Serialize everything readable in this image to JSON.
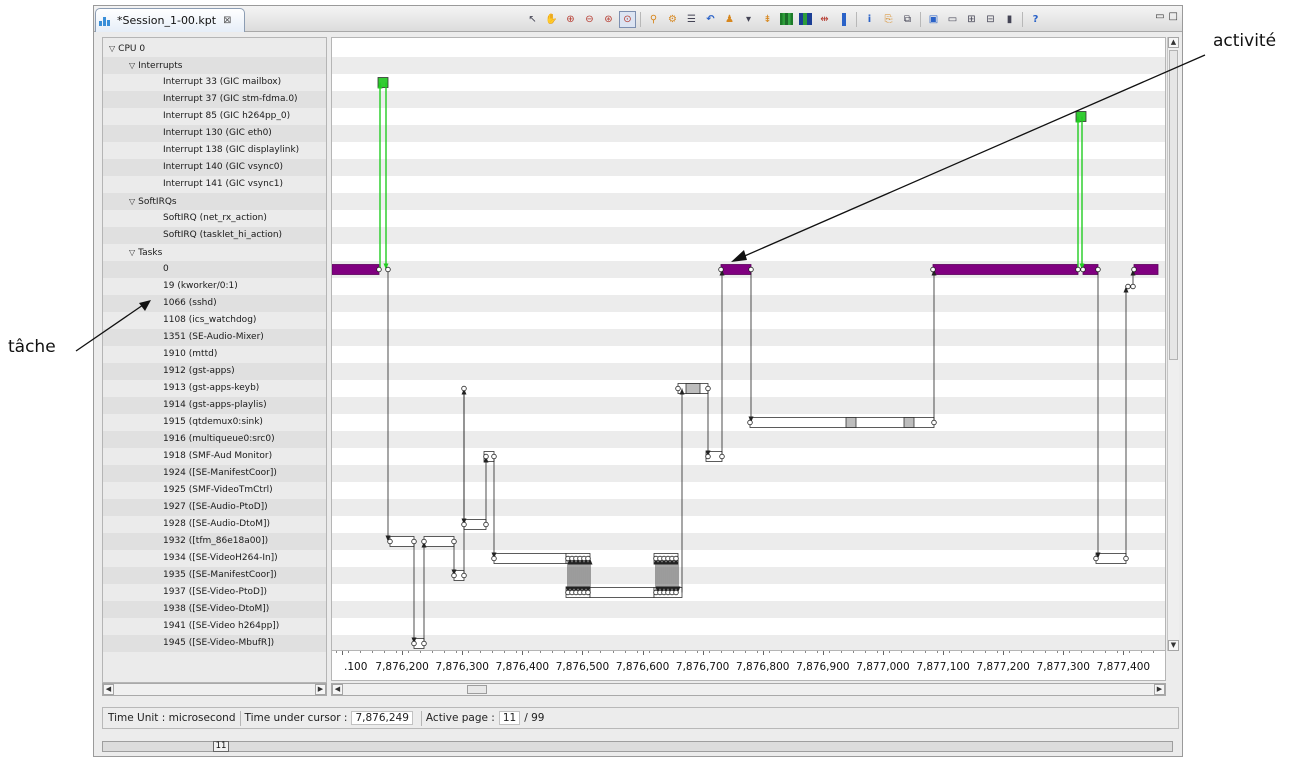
{
  "tab": {
    "title": "*Session_1-00.kpt",
    "close_glyph": "⊠"
  },
  "toolbar": {
    "icons": [
      "arrow-pointer-icon",
      "hand-pan-icon",
      "zoom-in-icon",
      "zoom-out-icon",
      "zoom-fit-icon",
      "zoom-select-icon",
      "filter-icon",
      "filter-edit-icon",
      "list-icon",
      "undo-icon",
      "user-icon",
      "dropdown-icon",
      "expand-icon",
      "graph-icon",
      "graph-alt-icon",
      "split-icon",
      "vertical-bar-icon",
      "info-icon",
      "export-icon",
      "copy-icon",
      "settings-icon",
      "window-icon",
      "tiles-icon",
      "layout-icon",
      "bar-chart-icon",
      "help-icon"
    ]
  },
  "tree": {
    "rows": [
      {
        "label": "CPU 0",
        "level": 0,
        "expander": "▽"
      },
      {
        "label": "Interrupts",
        "level": 1,
        "expander": "▽"
      },
      {
        "label": "Interrupt 33 (GIC  mailbox)",
        "level": 2
      },
      {
        "label": "Interrupt 37 (GIC  stm-fdma.0)",
        "level": 2
      },
      {
        "label": "Interrupt 85 (GIC  h264pp_0)",
        "level": 2
      },
      {
        "label": "Interrupt 130 (GIC  eth0)",
        "level": 2
      },
      {
        "label": "Interrupt 138 (GIC  displaylink)",
        "level": 2
      },
      {
        "label": "Interrupt 140 (GIC  vsync0)",
        "level": 2
      },
      {
        "label": "Interrupt 141 (GIC  vsync1)",
        "level": 2
      },
      {
        "label": "SoftIRQs",
        "level": 1,
        "expander": "▽"
      },
      {
        "label": "SoftIRQ (net_rx_action)",
        "level": 2
      },
      {
        "label": "SoftIRQ (tasklet_hi_action)",
        "level": 2
      },
      {
        "label": "Tasks",
        "level": 1,
        "expander": "▽"
      },
      {
        "label": "0",
        "level": 2
      },
      {
        "label": "19 (kworker/0:1)",
        "level": 2
      },
      {
        "label": "1066 (sshd)",
        "level": 2
      },
      {
        "label": "1108 (ics_watchdog)",
        "level": 2
      },
      {
        "label": "1351 (SE-Audio-Mixer)",
        "level": 2
      },
      {
        "label": "1910 (mttd)",
        "level": 2
      },
      {
        "label": "1912 (gst-apps)",
        "level": 2
      },
      {
        "label": "1913 (gst-apps-keyb)",
        "level": 2
      },
      {
        "label": "1914 (gst-apps-playlis)",
        "level": 2
      },
      {
        "label": "1915 (qtdemux0:sink)",
        "level": 2
      },
      {
        "label": "1916 (multiqueue0:src0)",
        "level": 2
      },
      {
        "label": "1918 (SMF-Aud Monitor)",
        "level": 2
      },
      {
        "label": "1924 ([SE-ManifestCoor])",
        "level": 2
      },
      {
        "label": "1925 (SMF-VideoTmCtrl)",
        "level": 2
      },
      {
        "label": "1927 ([SE-Audio-PtoD])",
        "level": 2
      },
      {
        "label": "1928 ([SE-Audio-DtoM])",
        "level": 2
      },
      {
        "label": "1932 ([tfm_86e18a00])",
        "level": 2
      },
      {
        "label": "1934 ([SE-VideoH264-In])",
        "level": 2
      },
      {
        "label": "1935 ([SE-ManifestCoor])",
        "level": 2
      },
      {
        "label": "1937 ([SE-Video-PtoD])",
        "level": 2
      },
      {
        "label": "1938 ([SE-Video-DtoM])",
        "level": 2
      },
      {
        "label": "1941 ([SE-Video h264pp])",
        "level": 2
      },
      {
        "label": "1945 ([SE-Video-MbufR])",
        "level": 2
      }
    ]
  },
  "timeline": {
    "axis_labels": [
      ".100",
      "7,876,200",
      "7,876,300",
      "7,876,400",
      "7,876,500",
      "7,876,600",
      "7,876,700",
      "7,876,800",
      "7,876,900",
      "7,877,000",
      "7,877,100",
      "7,877,200",
      "7,877,300",
      "7,877,400"
    ],
    "colors": {
      "running": "#800080",
      "wakeup": "#22cc22",
      "grid_alt": "#ececec",
      "idle_fill": "#ffffff",
      "waiting_fill": "#bdbdbd"
    }
  },
  "status": {
    "time_unit_label": "Time Unit : microsecond",
    "time_under_cursor_label": "Time under cursor :",
    "time_under_cursor_value": "7,876,249",
    "active_page_label": "Active page :",
    "active_page_value": "11",
    "total_pages": "/ 99"
  },
  "pager": {
    "current": "11"
  },
  "annotations": {
    "activity": "activité",
    "task": "tâche"
  }
}
